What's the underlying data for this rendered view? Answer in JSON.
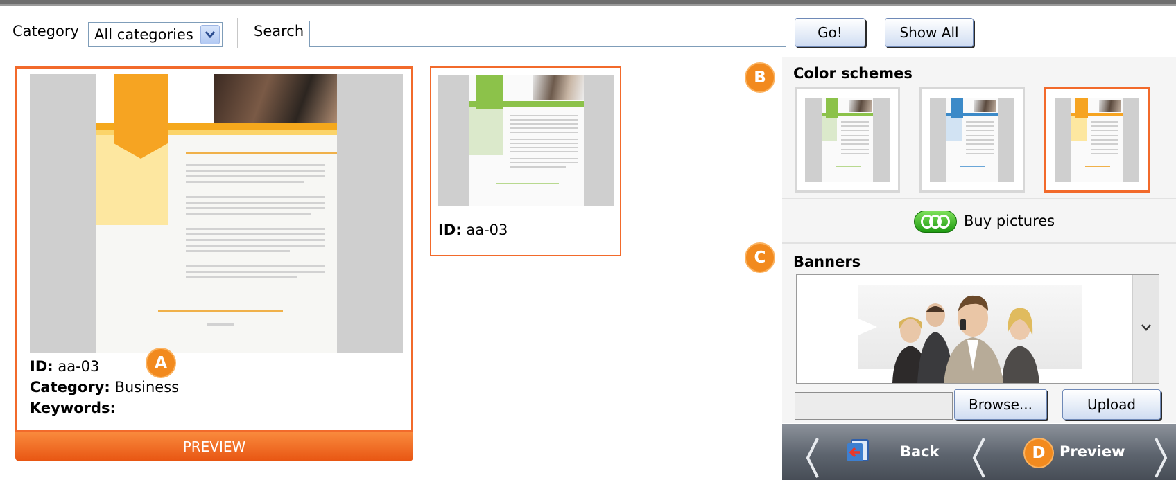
{
  "toolbar": {
    "category_label": "Category",
    "category_value": "All categories",
    "search_label": "Search",
    "search_value": "",
    "go_label": "Go!",
    "show_all_label": "Show All"
  },
  "templates": [
    {
      "id_label": "ID:",
      "id_value": "aa-03",
      "category_label": "Category:",
      "category_value": "Business",
      "keywords_label": "Keywords:",
      "preview_label": "PREVIEW",
      "selected": true
    },
    {
      "id_label": "ID:",
      "id_value": "aa-03",
      "selected": false
    }
  ],
  "markers": {
    "a": "A",
    "b": "B",
    "c": "C",
    "d": "D"
  },
  "right_panel": {
    "color_schemes_title": "Color schemes",
    "schemes": [
      {
        "color": "#8cc24a",
        "selected": false
      },
      {
        "color": "#3c8ac8",
        "selected": false
      },
      {
        "color": "#f6a422",
        "selected": true
      }
    ],
    "buy_pictures_label": "Buy pictures",
    "banners_title": "Banners",
    "browse_label": "Browse...",
    "upload_label": "Upload"
  },
  "navigation": {
    "back_label": "Back",
    "preview_label": "Preview"
  },
  "colors": {
    "accent": "#f26a2b",
    "preview_bar": "#e85512",
    "marker": "#f28a1e",
    "nav_bar": "#5d646e"
  }
}
